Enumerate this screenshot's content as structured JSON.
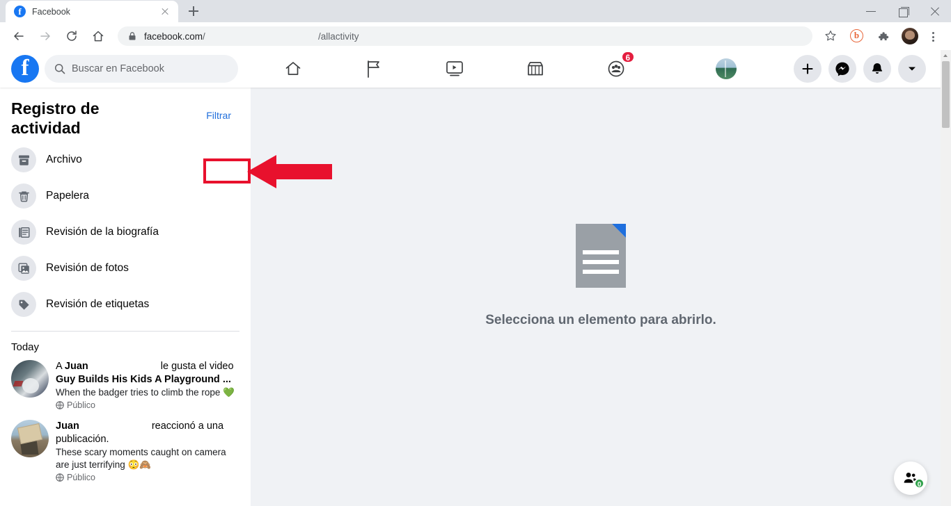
{
  "browser": {
    "tab": {
      "title": "Facebook",
      "favicon": "facebook-icon"
    },
    "new_tab_label": "+",
    "window_controls": {
      "minimize": "minimize-icon",
      "maximize": "maximize-icon",
      "close": "close-icon"
    },
    "nav": {
      "back": "back-arrow-icon",
      "forward": "forward-arrow-icon",
      "reload": "reload-icon",
      "home": "home-icon"
    },
    "omnibox": {
      "lock": "lock-icon",
      "url_domain": "facebook.com",
      "url_slash": "/",
      "url_path": "/allactivity"
    },
    "toolbar_icons": {
      "bookmark": "star-icon",
      "extension_b": "b",
      "extensions": "puzzle-icon",
      "profile": "profile-avatar",
      "menu": "kebab-menu-icon"
    }
  },
  "facebook": {
    "logo": "facebook-logo",
    "search": {
      "placeholder": "Buscar en Facebook",
      "icon": "search-icon"
    },
    "nav_icons": [
      {
        "name": "home-icon",
        "label": "Inicio"
      },
      {
        "name": "flag-icon",
        "label": "Páginas"
      },
      {
        "name": "video-icon",
        "label": "Video"
      },
      {
        "name": "marketplace-icon",
        "label": "Marketplace"
      },
      {
        "name": "groups-icon",
        "label": "Grupos",
        "badge": "6"
      }
    ],
    "right_icons": [
      {
        "name": "account-avatar"
      },
      {
        "name": "plus-icon"
      },
      {
        "name": "messenger-icon"
      },
      {
        "name": "bell-icon"
      },
      {
        "name": "chevron-down-icon"
      }
    ]
  },
  "activity_log": {
    "title": "Registro de actividad",
    "filter_label": "Filtrar",
    "nav_items": [
      {
        "icon": "archive-icon",
        "label": "Archivo"
      },
      {
        "icon": "trash-icon",
        "label": "Papelera"
      },
      {
        "icon": "timeline-icon",
        "label": "Revisión de la biografía"
      },
      {
        "icon": "photos-icon",
        "label": "Revisión de fotos"
      },
      {
        "icon": "tag-icon",
        "label": "Revisión de etiquetas"
      }
    ],
    "section_label": "Today",
    "entries": [
      {
        "actor_prefix": "A",
        "actor": "Juan",
        "action": "le gusta el video",
        "title": "Guy Builds His Kids A Playground ...",
        "snippet": "When the badger tries to climb the rope 💚",
        "privacy": "Público",
        "privacy_icon": "globe-icon"
      },
      {
        "actor_prefix": "",
        "actor": "Juan",
        "action": "reaccionó a una publicación.",
        "title": "",
        "snippet": "These scary moments caught on camera are just terrifying 😳🙈",
        "privacy": "Público",
        "privacy_icon": "globe-icon"
      }
    ]
  },
  "main": {
    "empty_icon": "document-icon",
    "empty_text": "Selecciona un elemento para abrirlo."
  },
  "contacts_fab": {
    "icon": "contacts-icon",
    "badge": "0"
  },
  "colors": {
    "fb_blue": "#1877f2",
    "link_blue": "#216fdb",
    "annotation_red": "#e8112d",
    "page_bg": "#f0f2f5",
    "badge_red": "#e41e3f",
    "badge_green": "#31a24c"
  }
}
